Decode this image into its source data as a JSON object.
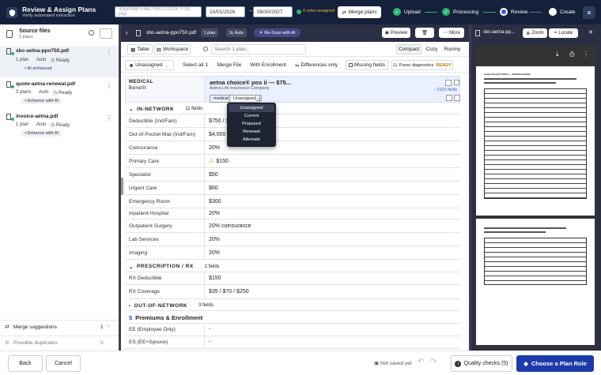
{
  "header": {
    "title": "Review & Assign Plans",
    "subtitle": "Verify automated extraction",
    "imported_placeholder": "Imported Files 09/07/2026 9:39 PM",
    "date_from": "10/01/2026",
    "date_to": "09/30/2027",
    "roles_assigned": "0 roles assigned",
    "merge_plans": "Merge plans",
    "steps": [
      {
        "label": "Upload",
        "state": "done"
      },
      {
        "label": "Processing",
        "state": "done"
      },
      {
        "label": "Review",
        "state": "current"
      },
      {
        "label": "Create",
        "state": "todo"
      }
    ],
    "colors": {
      "header_bg": "#15213a",
      "step_done": "#2fb46e",
      "step_current": "#2f5fd6"
    }
  },
  "sidebar": {
    "title": "Source files",
    "count": "5 plans",
    "files": [
      {
        "name": "sbc-aetna-ppo750.pdf",
        "plans": "1 plan",
        "mode": "Auto",
        "status": "Ready",
        "badge": "AI enhanced"
      },
      {
        "name": "quote-aetna-renewal.pdf",
        "plans": "3 plans",
        "mode": "Auto",
        "status": "Ready",
        "badge": "Enhance with AI"
      },
      {
        "name": "invoice-aetna.pdf",
        "plans": "1 plan",
        "mode": "Auto",
        "status": "Ready",
        "badge": "Enhance with AI"
      }
    ],
    "bottom": [
      {
        "label": "Merge suggestions",
        "count": "1"
      },
      {
        "label": "Possible duplicates",
        "count": "0"
      }
    ],
    "back": "Back",
    "cancel": "Cancel"
  },
  "tabbar": {
    "file": "sbc-aetna-ppo750.pdf",
    "plans": "1 plan",
    "mode": "Auto",
    "rescan": "Re-Scan with AI",
    "preview": "Preview",
    "more": "More",
    "right_tab": "sbc-aetna-pp..."
  },
  "toolbar": {
    "views": [
      "Table",
      "Workspace"
    ],
    "search_placeholder": "Search 1 plan...",
    "density": [
      "Compact",
      "Cozy",
      "Roomy"
    ]
  },
  "filters": {
    "unassigned": "Unassigned",
    "select_all": "Select all",
    "select_count": "1",
    "merge_file": "Merge File",
    "with_enrollment": "With Enrollment",
    "differences": "Differences only",
    "missing": "Missing fields",
    "parse_diag": "Parse diagnostics",
    "parse_status": "READY"
  },
  "table": {
    "col_header_top": "MEDICAL",
    "col_header_bottom": "Benefit",
    "plan_name": "aetna choice® pos ii — $75...",
    "carrier": "Aetna Life Insurance Company",
    "chips": [
      "medical",
      "Unassigned"
    ],
    "fields_found": "10/23 fields",
    "sections": [
      {
        "name": "IN-NETWORK",
        "count": "11 fields"
      },
      {
        "name": "PRESCRIPTION / RX",
        "count": "2 fields"
      },
      {
        "name": "OUT-OF-NETWORK",
        "count": "3 fields"
      }
    ],
    "rows_in": [
      {
        "label": "Deductible (Ind/Fam)",
        "value": "$750 / $1,500"
      },
      {
        "label": "Out-of-Pocket Max (Ind/Fam)",
        "value": "$4,000 / $8,000"
      },
      {
        "label": "Coinsurance",
        "value": "20%"
      },
      {
        "label": "Primary Care",
        "value": "$150"
      },
      {
        "label": "Specialist",
        "value": "$50"
      },
      {
        "label": "Urgent Care",
        "value": "$60"
      },
      {
        "label": "Emergency Room",
        "value": "$300"
      },
      {
        "label": "Inpatient Hospital",
        "value": "20%"
      },
      {
        "label": "Outpatient Surgery",
        "value": "20% coinsurance"
      },
      {
        "label": "Lab Services",
        "value": "20%"
      },
      {
        "label": "Imaging",
        "value": "20%"
      }
    ],
    "rows_rx": [
      {
        "label": "RX Deductible",
        "value": "$150"
      },
      {
        "label": "RX Coverage",
        "value": "$35 / $70 / $250"
      }
    ],
    "premiums": "Premiums & Enrollment",
    "rows_prem": [
      {
        "label": "EE (Employee Only)",
        "value": "-"
      },
      {
        "label": "ES (EE+Spouse)",
        "value": "-"
      }
    ]
  },
  "dropdown": {
    "options": [
      "Unassigned",
      "Current",
      "Proposed",
      "Renewal",
      "Alternate"
    ]
  },
  "preview": {
    "zoom": "Zoom",
    "locate": "Locate",
    "doc_title": "Aetna Choice® POS II — $750 Deductible"
  },
  "footer": {
    "not_saved": "Not saved yet",
    "quality": "Quality checks (5)",
    "choose": "Choose a Plan Role"
  }
}
